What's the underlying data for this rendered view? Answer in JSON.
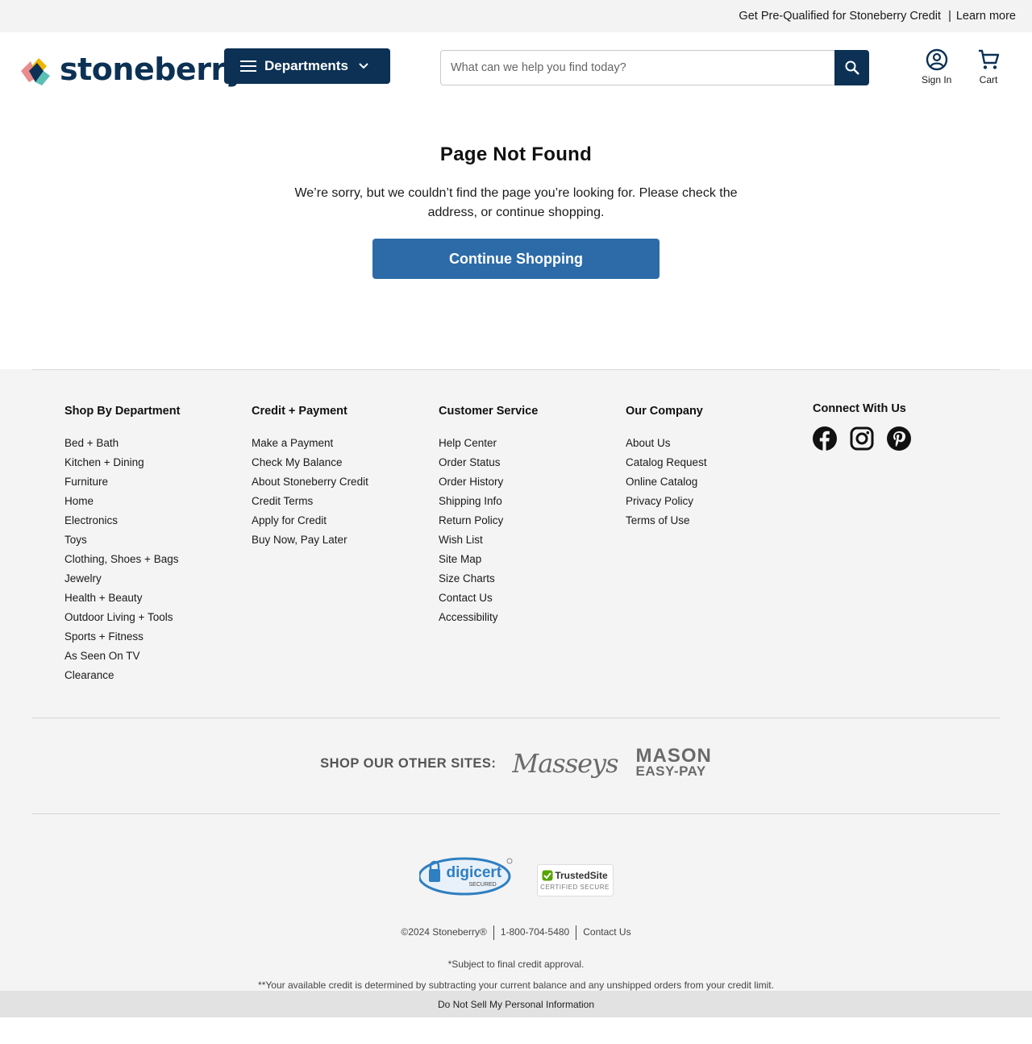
{
  "promo": {
    "text": "Get Pre-Qualified for Stoneberry Credit",
    "separator": "|",
    "link": "Learn more"
  },
  "header": {
    "logo_text": "stoneberry",
    "departments_label": "Departments",
    "search_placeholder": "What can we help you find today?",
    "sign_in": "Sign In",
    "cart": "Cart"
  },
  "main": {
    "title": "Page Not Found",
    "message": "We’re sorry, but we couldn’t find the page you’re looking for. Please check the address, or continue shopping.",
    "button": "Continue Shopping"
  },
  "footer": {
    "shop_by_department": {
      "title": "Shop By Department",
      "items": [
        "Bed + Bath",
        "Kitchen + Dining",
        "Furniture",
        "Home",
        "Electronics",
        "Toys",
        "Clothing, Shoes + Bags",
        "Jewelry",
        "Health + Beauty",
        "Outdoor Living + Tools",
        "Sports + Fitness",
        "As Seen On TV",
        "Clearance"
      ]
    },
    "credit_payment": {
      "title": "Credit + Payment",
      "items": [
        "Make a Payment",
        "Check My Balance",
        "About Stoneberry Credit",
        "Credit Terms",
        "Apply for Credit",
        "Buy Now, Pay Later"
      ]
    },
    "customer_service": {
      "title": "Customer Service",
      "items": [
        "Help Center",
        "Order Status",
        "Order History",
        "Shipping Info",
        "Return Policy",
        "Wish List",
        "Site Map",
        "Size Charts",
        "Contact Us",
        "Accessibility"
      ]
    },
    "our_company": {
      "title": "Our Company",
      "items": [
        "About Us",
        "Catalog Request",
        "Online Catalog",
        "Privacy Policy",
        "Terms of Use"
      ]
    },
    "connect": {
      "title": "Connect With Us"
    },
    "other_sites": {
      "label": "SHOP OUR OTHER SITES:",
      "masseys": "Masseys",
      "mason_line1": "MASON",
      "mason_line2": "EASY-PAY"
    },
    "badges": {
      "digicert": "digicert",
      "digicert_sub": "SECURED",
      "trusted": "TrustedSite",
      "trusted_sub": "CERTIFIED SECURE"
    },
    "copyright": "©2024 Stoneberry®",
    "phone": "1-800-704-5480",
    "contact": "Contact Us",
    "note1": "*Subject to final credit approval.",
    "note2": "**Your available credit is determined by subtracting your current balance and any unshipped orders from your credit limit.",
    "do_not_sell": "Do Not Sell My Personal Information"
  },
  "colors": {
    "navy": "#0c3154",
    "button_blue": "#2c6ba8",
    "footer_bg": "#f4f4f4"
  }
}
